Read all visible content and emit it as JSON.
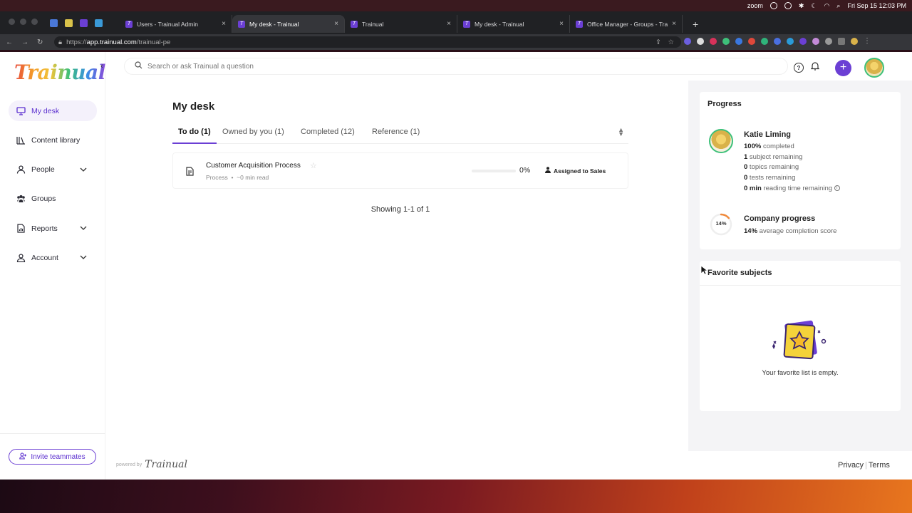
{
  "os": {
    "menubar_app": "zoom",
    "clock": "Fri Sep 15  12:03 PM"
  },
  "browser": {
    "tabs": [
      {
        "title": "Users - Trainual Admin",
        "active": false
      },
      {
        "title": "My desk - Trainual",
        "active": true
      },
      {
        "title": "Trainual",
        "active": false
      },
      {
        "title": "My desk - Trainual",
        "active": false
      },
      {
        "title": "Office Manager - Groups - Trai",
        "active": false
      }
    ],
    "url_scheme": "https://",
    "url_host": "app.trainual.com",
    "url_path": "/trainual-pe"
  },
  "app": {
    "logo": "Trainual",
    "search_placeholder": "Search or ask Trainual a question",
    "nav": [
      {
        "label": "My desk",
        "icon": "desk-icon",
        "active": true
      },
      {
        "label": "Content library",
        "icon": "library-icon"
      },
      {
        "label": "People",
        "icon": "person-icon",
        "has_children": true
      },
      {
        "label": "Groups",
        "icon": "groups-icon"
      },
      {
        "label": "Reports",
        "icon": "report-icon",
        "has_children": true
      },
      {
        "label": "Account",
        "icon": "account-icon",
        "has_children": true
      }
    ],
    "invite_label": "Invite teammates",
    "powered_by": "powered by",
    "footer_logo": "Trainual",
    "footer_links": {
      "privacy": "Privacy",
      "terms": "Terms"
    }
  },
  "main": {
    "title": "My desk",
    "tabs": [
      {
        "label": "To do (1)",
        "selected": true
      },
      {
        "label": "Owned by you (1)"
      },
      {
        "label": "Completed (12)"
      },
      {
        "label": "Reference (1)"
      }
    ],
    "rows": [
      {
        "name": "Customer Acquisition Process",
        "type": "Process",
        "read_time": "~0 min read",
        "progress_label": "0%",
        "progress": 0,
        "assigned": "Assigned to Sales"
      }
    ],
    "showing": "Showing 1-1 of 1"
  },
  "progress_card": {
    "title": "Progress",
    "user_name": "Katie Liming",
    "stats": [
      {
        "value": "100%",
        "text": " completed"
      },
      {
        "value": "1",
        "text": " subject remaining"
      },
      {
        "value": "0",
        "text": " topics remaining"
      },
      {
        "value": "0",
        "text": " tests remaining"
      },
      {
        "value": "0 min",
        "text": " reading time remaining"
      }
    ],
    "company_title": "Company progress",
    "company_pct_label": "14%",
    "company_pct": 14,
    "company_sub": " average completion score"
  },
  "favorites_card": {
    "title": "Favorite subjects",
    "empty_text": "Your favorite list is empty."
  },
  "colors": {
    "accent": "#6b3fd4",
    "ring": "#f08a3c",
    "avatar_ring": "#3ec07a"
  }
}
